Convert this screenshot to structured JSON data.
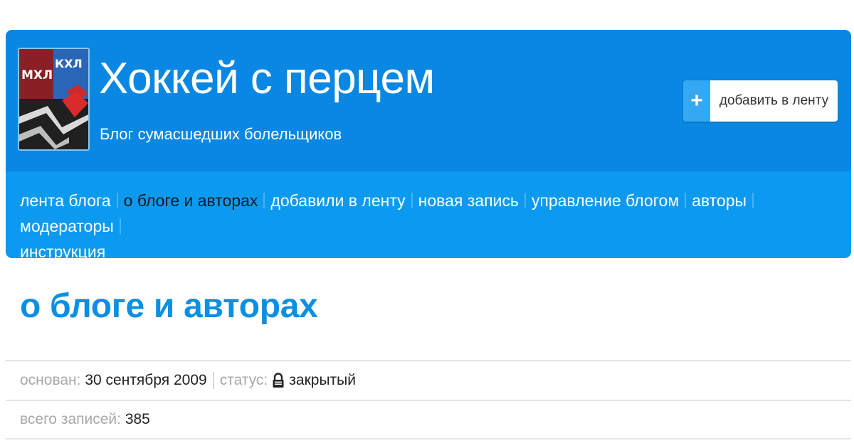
{
  "header": {
    "title": "Хоккей с перцем",
    "subtitle": "Блог сумасшедших болельщиков",
    "logo_text": [
      "МХЛ",
      "КХЛ"
    ],
    "add_button": {
      "icon": "plus-icon",
      "plus_symbol": "+",
      "label": "добавить в ленту"
    }
  },
  "nav": {
    "items": [
      {
        "label": "лента блога",
        "active": false
      },
      {
        "label": "о блоге и авторах",
        "active": true
      },
      {
        "label": "добавили в ленту",
        "active": false
      },
      {
        "label": "новая запись",
        "active": false
      },
      {
        "label": "управление блогом",
        "active": false
      },
      {
        "label": "авторы",
        "active": false
      },
      {
        "label": "модераторы",
        "active": false
      },
      {
        "label": "инструкция",
        "active": false
      }
    ]
  },
  "page": {
    "title": "о блоге и авторах",
    "info": {
      "founded_label": "основан:",
      "founded_value": "30 сентября 2009",
      "status_label": "статус:",
      "status_icon": "lock-icon",
      "status_value": "закрытый",
      "posts_label": "всего записей:",
      "posts_value": "385"
    }
  },
  "colors": {
    "header_dark": "#0a87e2",
    "nav_bar": "#0b9af0",
    "title_blue": "#0b8fe2",
    "active_nav": "#1a1a1a"
  }
}
